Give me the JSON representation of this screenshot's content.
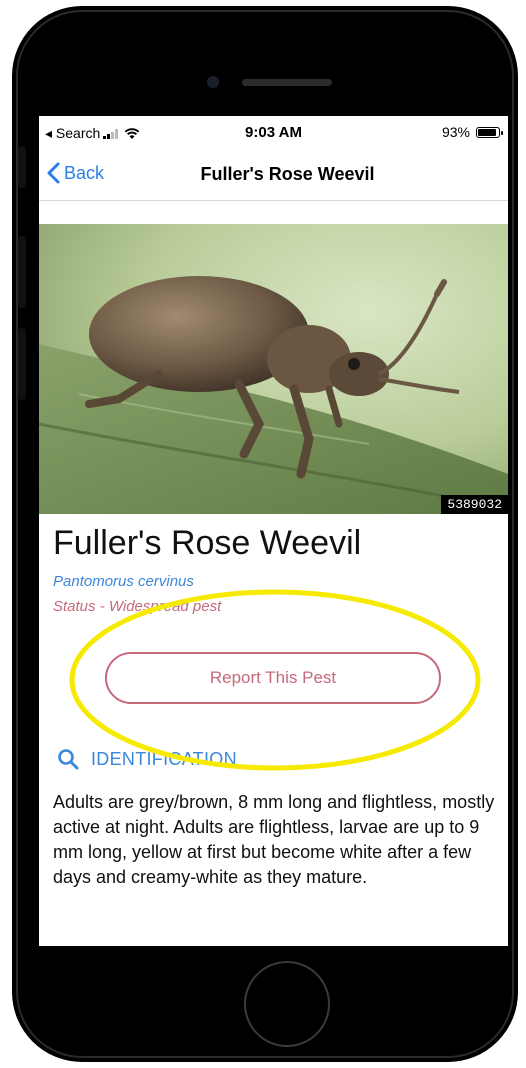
{
  "status_bar": {
    "carrier": "◂ Search",
    "time": "9:03 AM",
    "battery_pct": "93%",
    "battery_level": 0.93
  },
  "nav": {
    "back_label": "Back",
    "title": "Fuller's Rose Weevil"
  },
  "photo": {
    "id": "5389032"
  },
  "pest": {
    "name": "Fuller's Rose Weevil",
    "scientific_name": "Pantomorus cervinus",
    "status": "Status - Widespread pest",
    "report_label": "Report This Pest"
  },
  "identification": {
    "heading": "IDENTIFICATION",
    "description": "Adults are grey/brown, 8 mm long and flightless, mostly active at night. Adults are flightless, larvae are up to 9 mm long, yellow at first but become white after a few days and creamy-white as they mature."
  },
  "colors": {
    "link_blue": "#2b7de9",
    "accent_pink": "#c46a7a",
    "highlight_yellow": "#f5ea00"
  }
}
